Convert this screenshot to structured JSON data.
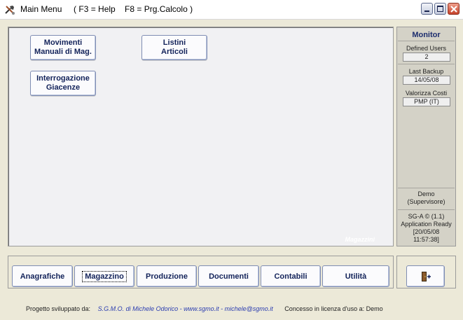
{
  "window": {
    "title": "Main Menu     ( F3 = Help    F8 = Prg.Calcolo )"
  },
  "main": {
    "section_label": "Magazzini",
    "buttons": [
      {
        "label": "Movimenti\nManuali di Mag."
      },
      {
        "label": "Listini\nArticoli"
      },
      {
        "label": "Interrogazione\nGiacenze"
      }
    ]
  },
  "monitor": {
    "title": "Monitor",
    "defined_users_label": "Defined Users",
    "defined_users_value": "2",
    "last_backup_label": "Last Backup",
    "last_backup_value": "14/05/08",
    "valorizza_label": "Valorizza Costi",
    "valorizza_value": "PMP (IT)",
    "user_line1": "Demo",
    "user_line2": "(Supervisore)",
    "app_line1": "SG-A © (1.1)",
    "app_line2": "Application Ready",
    "app_line3": "[20/05/08",
    "app_line4": "11:57:38]"
  },
  "nav": {
    "items": [
      {
        "label": "Anagrafiche"
      },
      {
        "label": "Magazzino"
      },
      {
        "label": "Produzione"
      },
      {
        "label": "Documenti"
      },
      {
        "label": "Contabili"
      },
      {
        "label": "Utilità"
      }
    ],
    "active": "Magazzino"
  },
  "exit": {
    "icon": "exit-door-icon"
  },
  "footer": {
    "prefix": "Progetto sviluppato da:",
    "credit": "S.G.M.O. di Michele Odorico  -  www.sgmo.it  -  michele@sgmo.it",
    "license": "Concesso in licenza d'uso a: Demo"
  },
  "colors": {
    "button_text": "#13235a",
    "monitor_bg": "#d4d2c7",
    "panel_bg": "#f1f1f3",
    "credit_link": "#2a3cb0"
  }
}
